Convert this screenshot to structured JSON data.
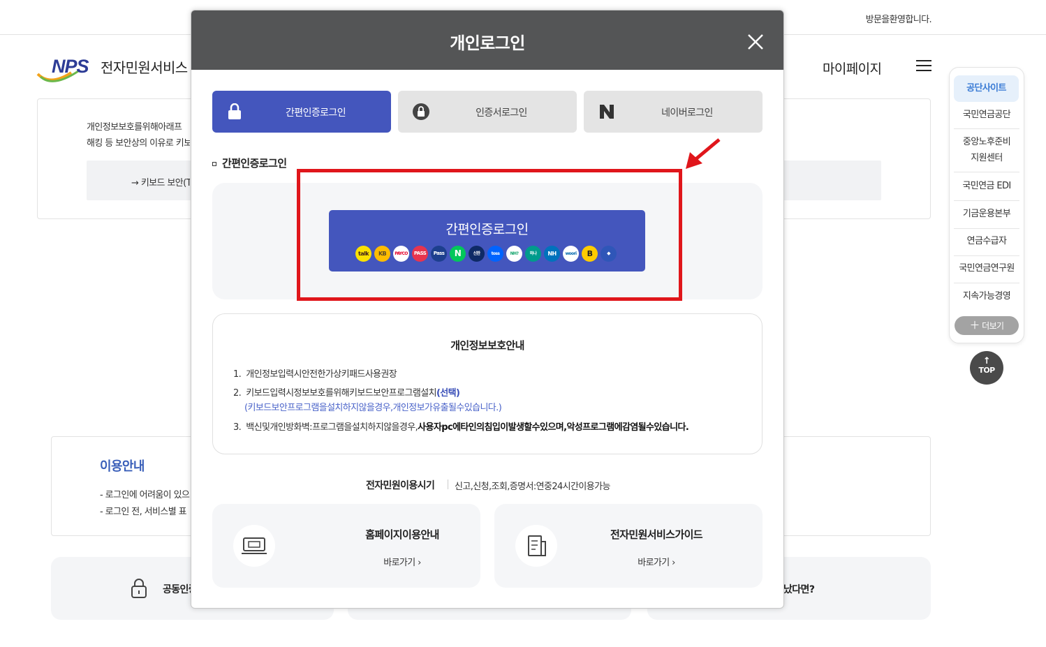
{
  "header": {
    "welcome": "방문을환영합니다.",
    "logo_mark": "NPS",
    "logo_text": "전자민원서비스",
    "mypage": "마이페이지"
  },
  "background": {
    "notice_line1": "개인정보보호를위해아래프",
    "notice_line2": "해킹 등 보안상의 이유로 키보",
    "keyboard_link": "→ 키보드 보안(T",
    "usage_title": "이용안내",
    "usage_line1": "- 로그인에 어려움이 있으",
    "usage_line2": "- 로그인 전, 서비스별 표",
    "card1": "공동인증",
    "card3": "났다면?"
  },
  "sidebar": {
    "active": "공단사이트",
    "items": [
      "국민연금공단",
      "중앙노후준비",
      "지원센터",
      "국민연금 EDI",
      "기금운용본부",
      "연금수급자",
      "국민연금연구원",
      "지속가능경영"
    ],
    "more": "더보기",
    "top": "TOP"
  },
  "modal": {
    "title": "개인로그인",
    "tabs": [
      {
        "label": "간편인증로그인"
      },
      {
        "label": "인증서로그인"
      },
      {
        "label": "네이버로그인"
      }
    ],
    "section_label": "간편인증로그인",
    "easy_button": "간편인증로그인",
    "providers": [
      "talk",
      "KB",
      "PAYCO",
      "PASS",
      "Pass",
      "N",
      "신한",
      "toss",
      "NH?",
      "하나",
      "NH",
      "woori",
      "B",
      "shield"
    ],
    "privacy": {
      "title": "개인정보보호안내",
      "item1_num": "1.",
      "item1": "개인정보입력시안전한가상키패드사용권장",
      "item2_num": "2.",
      "item2": "키보드입력시정보보호를위해키보드보안프로그램설치",
      "item2_em": "(선택)",
      "item2_sub": "(키보드보안프로그램을설치하지않을경우,개인정보가유출될수있습니다.)",
      "item3_num": "3.",
      "item3": "백신및개인방화벽:프로그램을설치하지않을경우,",
      "item3_bold": "사용자pc에타인의침입이발생할수있으며,악성프로그램에감염될수있습니다."
    },
    "hours_label": "전자민원이용시기",
    "hours_text": "신고,신청,조회,증명서:연중24시간이용가능",
    "guides": [
      {
        "title": "홈페이지이용안내",
        "link": "바로가기  ›"
      },
      {
        "title": "전자민원서비스가이드",
        "link": "바로가기  ›"
      }
    ]
  },
  "colors": {
    "accent": "#4456bd",
    "header_bg": "#545556",
    "highlight": "#e0161b"
  }
}
